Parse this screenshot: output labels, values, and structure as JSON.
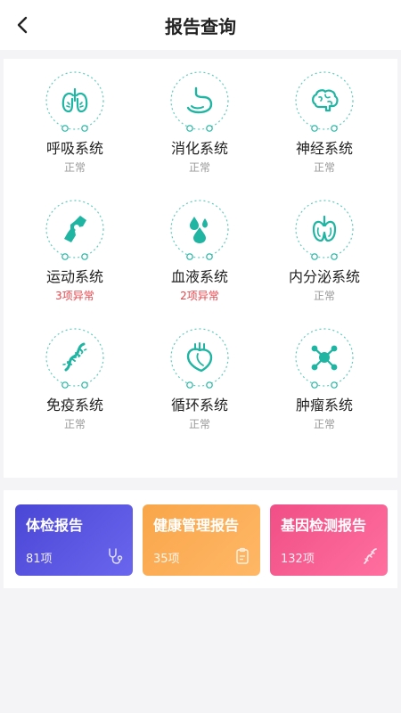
{
  "header": {
    "title": "报告查询",
    "back_icon": "chevron-left-icon"
  },
  "systems": [
    {
      "name": "呼吸系统",
      "status": "正常",
      "abnormal": false,
      "icon": "lungs-icon"
    },
    {
      "name": "消化系统",
      "status": "正常",
      "abnormal": false,
      "icon": "stomach-icon"
    },
    {
      "name": "神经系统",
      "status": "正常",
      "abnormal": false,
      "icon": "brain-icon"
    },
    {
      "name": "运动系统",
      "status": "3项异常",
      "abnormal": true,
      "icon": "joint-icon"
    },
    {
      "name": "血液系统",
      "status": "2项异常",
      "abnormal": true,
      "icon": "blood-drops-icon"
    },
    {
      "name": "内分泌系统",
      "status": "正常",
      "abnormal": false,
      "icon": "thyroid-icon"
    },
    {
      "name": "免疫系统",
      "status": "正常",
      "abnormal": false,
      "icon": "dna-icon"
    },
    {
      "name": "循环系统",
      "status": "正常",
      "abnormal": false,
      "icon": "heart-icon"
    },
    {
      "name": "肿瘤系统",
      "status": "正常",
      "abnormal": false,
      "icon": "molecule-icon"
    }
  ],
  "reports": [
    {
      "title": "体检报告",
      "count": "81项",
      "icon": "stethoscope-icon",
      "color_from": "#4b47d6",
      "color_to": "#6a66ee"
    },
    {
      "title": "健康管理报告",
      "count": "35项",
      "icon": "clipboard-icon",
      "color_from": "#f9a64a",
      "color_to": "#ffb766"
    },
    {
      "title": "基因检测报告",
      "count": "132项",
      "icon": "dna-icon",
      "color_from": "#f04f86",
      "color_to": "#ff6f9f"
    }
  ],
  "colors": {
    "accent": "#1fb5a2",
    "abnormal": "#e8444a",
    "muted": "#999999"
  }
}
